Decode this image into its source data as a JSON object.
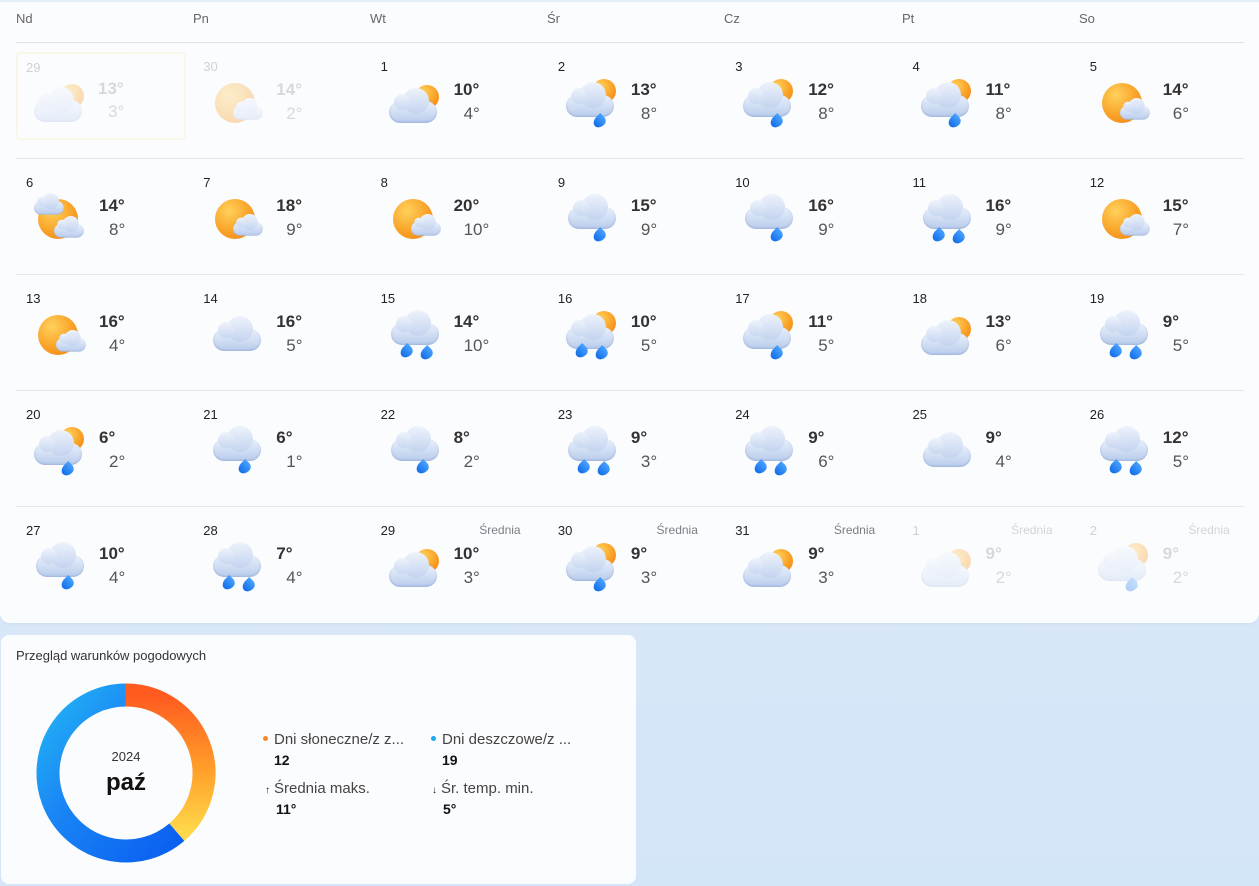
{
  "weekdays": [
    "Nd",
    "Pn",
    "Wt",
    "Śr",
    "Cz",
    "Pt",
    "So"
  ],
  "avg_label": "Średnia",
  "weeks": [
    [
      {
        "day": "29",
        "hi": "13°",
        "lo": "3°",
        "icon": "partly-cloudy-icon",
        "state": "today-dim"
      },
      {
        "day": "30",
        "hi": "14°",
        "lo": "2°",
        "icon": "sunny-cloud-icon",
        "state": "dim"
      },
      {
        "day": "1",
        "hi": "10°",
        "lo": "4°",
        "icon": "partly-cloudy-icon"
      },
      {
        "day": "2",
        "hi": "13°",
        "lo": "8°",
        "icon": "sun-rain-icon"
      },
      {
        "day": "3",
        "hi": "12°",
        "lo": "8°",
        "icon": "sun-rain-icon"
      },
      {
        "day": "4",
        "hi": "11°",
        "lo": "8°",
        "icon": "sun-rain-icon"
      },
      {
        "day": "5",
        "hi": "14°",
        "lo": "6°",
        "icon": "sunny-cloud-icon"
      }
    ],
    [
      {
        "day": "6",
        "hi": "14°",
        "lo": "8°",
        "icon": "sun-clouds-icon"
      },
      {
        "day": "7",
        "hi": "18°",
        "lo": "9°",
        "icon": "sunny-cloud-icon"
      },
      {
        "day": "8",
        "hi": "20°",
        "lo": "10°",
        "icon": "sunny-cloud-icon"
      },
      {
        "day": "9",
        "hi": "15°",
        "lo": "9°",
        "icon": "cloud-rain-icon"
      },
      {
        "day": "10",
        "hi": "16°",
        "lo": "9°",
        "icon": "cloud-rain-icon"
      },
      {
        "day": "11",
        "hi": "16°",
        "lo": "9°",
        "icon": "cloud-heavy-rain-icon"
      },
      {
        "day": "12",
        "hi": "15°",
        "lo": "7°",
        "icon": "sunny-cloud-icon"
      }
    ],
    [
      {
        "day": "13",
        "hi": "16°",
        "lo": "4°",
        "icon": "sunny-cloud-icon"
      },
      {
        "day": "14",
        "hi": "16°",
        "lo": "5°",
        "icon": "cloudy-icon"
      },
      {
        "day": "15",
        "hi": "14°",
        "lo": "10°",
        "icon": "cloud-heavy-rain-icon"
      },
      {
        "day": "16",
        "hi": "10°",
        "lo": "5°",
        "icon": "sun-heavy-rain-icon"
      },
      {
        "day": "17",
        "hi": "11°",
        "lo": "5°",
        "icon": "sun-rain-icon"
      },
      {
        "day": "18",
        "hi": "13°",
        "lo": "6°",
        "icon": "partly-cloudy-icon"
      },
      {
        "day": "19",
        "hi": "9°",
        "lo": "5°",
        "icon": "cloud-heavy-rain-icon"
      }
    ],
    [
      {
        "day": "20",
        "hi": "6°",
        "lo": "2°",
        "icon": "sun-rain-icon"
      },
      {
        "day": "21",
        "hi": "6°",
        "lo": "1°",
        "icon": "cloud-rain-icon"
      },
      {
        "day": "22",
        "hi": "8°",
        "lo": "2°",
        "icon": "cloud-rain-icon"
      },
      {
        "day": "23",
        "hi": "9°",
        "lo": "3°",
        "icon": "cloud-heavy-rain-icon"
      },
      {
        "day": "24",
        "hi": "9°",
        "lo": "6°",
        "icon": "cloud-heavy-rain-icon"
      },
      {
        "day": "25",
        "hi": "9°",
        "lo": "4°",
        "icon": "cloudy-icon"
      },
      {
        "day": "26",
        "hi": "12°",
        "lo": "5°",
        "icon": "cloud-heavy-rain-icon"
      }
    ],
    [
      {
        "day": "27",
        "hi": "10°",
        "lo": "4°",
        "icon": "cloud-rain-icon"
      },
      {
        "day": "28",
        "hi": "7°",
        "lo": "4°",
        "icon": "cloud-heavy-rain-icon"
      },
      {
        "day": "29",
        "hi": "10°",
        "lo": "3°",
        "icon": "partly-cloudy-icon",
        "avg": true
      },
      {
        "day": "30",
        "hi": "9°",
        "lo": "3°",
        "icon": "sun-rain-icon",
        "avg": true
      },
      {
        "day": "31",
        "hi": "9°",
        "lo": "3°",
        "icon": "partly-cloudy-icon",
        "avg": true
      },
      {
        "day": "1",
        "hi": "9°",
        "lo": "2°",
        "icon": "partly-cloudy-icon",
        "avg": true,
        "state": "dim"
      },
      {
        "day": "2",
        "hi": "9°",
        "lo": "2°",
        "icon": "sun-rain-icon",
        "avg": true,
        "state": "dim"
      }
    ]
  ],
  "summary": {
    "title": "Przegląd warunków pogodowych",
    "year": "2024",
    "month": "paź",
    "sunny_label": "Dni słoneczne/z z...",
    "sunny_value": "12",
    "rainy_label": "Dni deszczowe/z ...",
    "rainy_value": "19",
    "max_label": "Średnia maks.",
    "max_value": "11°",
    "min_label": "Śr. temp. min.",
    "min_value": "5°",
    "colors": {
      "sunny": "#f7872a",
      "rainy": "#1ca8f0"
    }
  },
  "chart_data": {
    "type": "pie",
    "categories": [
      "Dni słoneczne/z z...",
      "Dni deszczowe/z ..."
    ],
    "values": [
      12,
      19
    ]
  }
}
